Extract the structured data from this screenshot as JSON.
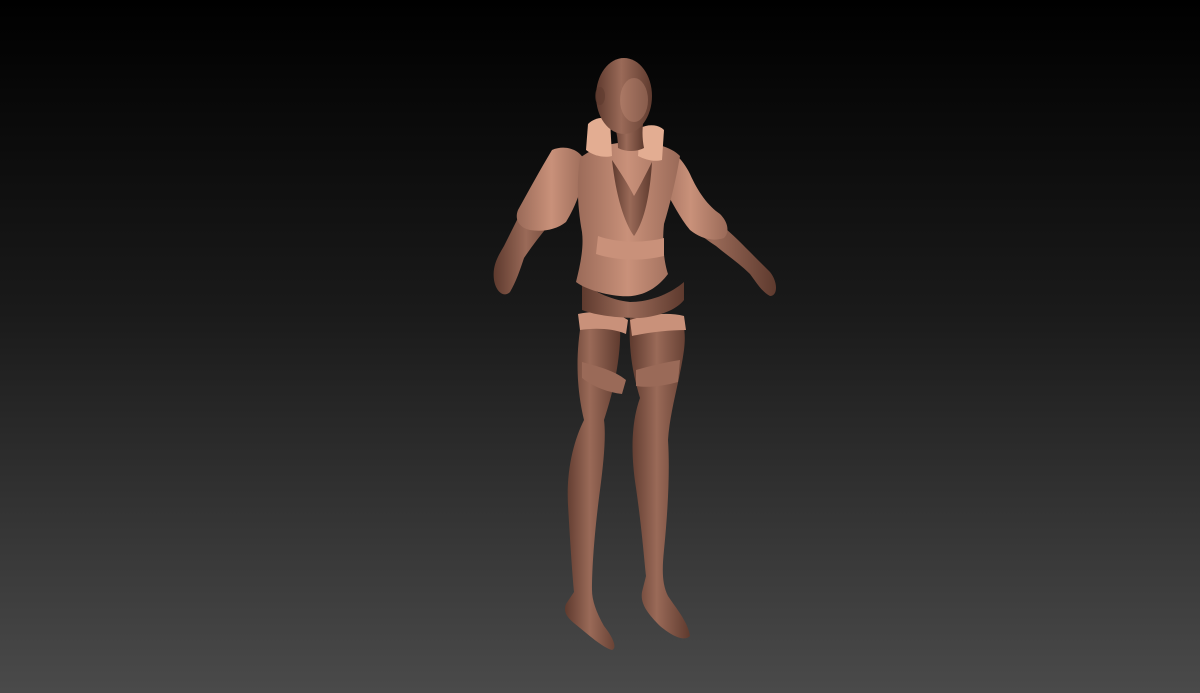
{
  "scene": {
    "subject": "sculpted-female-character-model",
    "pose": "a-pose",
    "colors": {
      "background_top": "#000000",
      "background_mid": "#1a1a1a",
      "background_bottom": "#4a4a4a",
      "clay_base": "#9a6a58",
      "clay_light": "#c9917a",
      "clay_shadow": "#5e3a2e",
      "clay_highlight": "#e3ad92"
    }
  }
}
